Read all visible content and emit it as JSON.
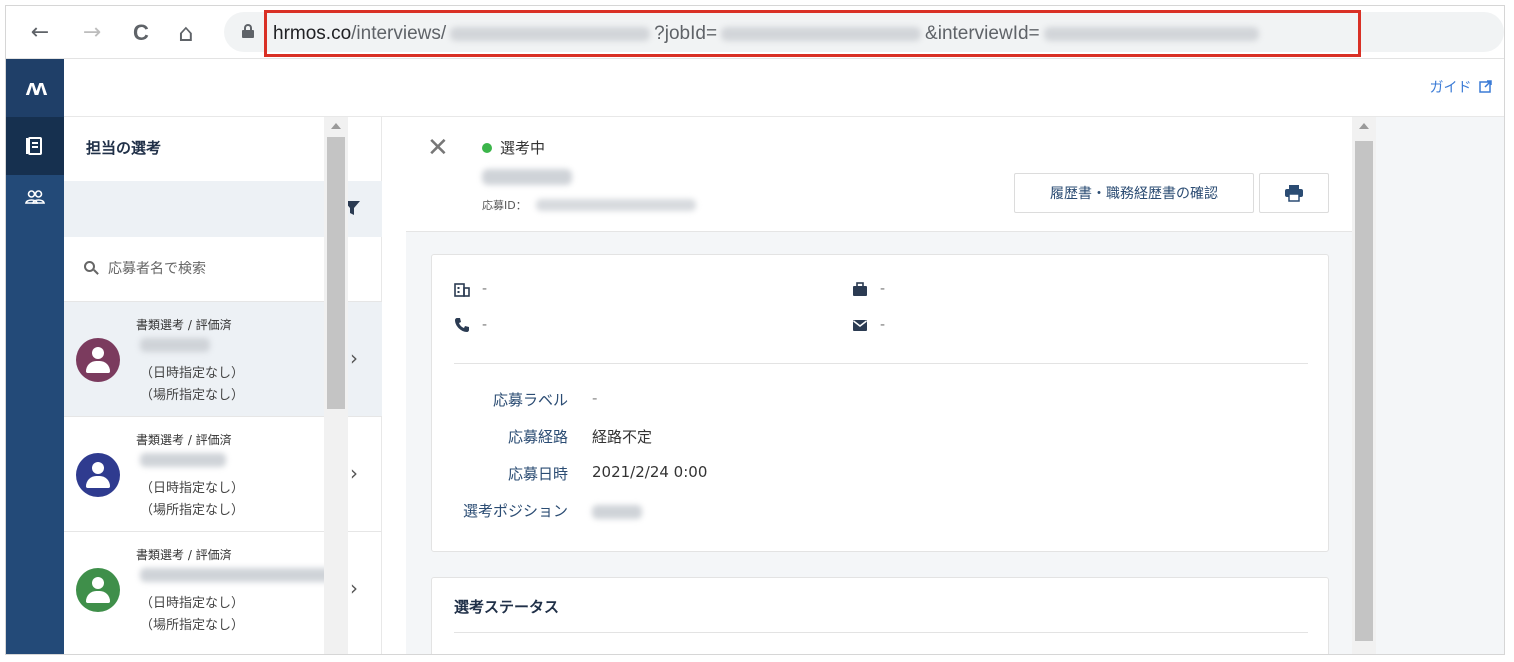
{
  "browser": {
    "back_icon": "←",
    "forward_icon": "→",
    "reload_icon": "C",
    "home_icon": "⌂",
    "url_host": "hrmos.co",
    "url_path": "/interviews/",
    "url_job_param": "?jobId=",
    "url_interview_param": "&interviewId="
  },
  "header": {
    "guide_label": "ガイド"
  },
  "rail": {
    "logo": "ʌʌ",
    "item_1_icon": "doc-icon",
    "item_2_icon": "people-icon"
  },
  "list": {
    "title": "担当の選考",
    "search_placeholder": "応募者名で検索",
    "candidates": [
      {
        "stage": "書類選考 / 評価済",
        "line1": "（日時指定なし）",
        "line2": "（場所指定なし）",
        "avatar_color": "#7b3b5e"
      },
      {
        "stage": "書類選考 / 評価済",
        "line1": "（日時指定なし）",
        "line2": "（場所指定なし）",
        "avatar_color": "#2f3b8f"
      },
      {
        "stage": "書類選考 / 評価済",
        "line1": "（日時指定なし）",
        "line2": "（場所指定なし）",
        "avatar_color": "#3f8f4a"
      }
    ]
  },
  "detail": {
    "status": "選考中",
    "status_color": "#3bb54a",
    "application_id_label": "応募ID：",
    "resume_button": "履歴書・職務経歴書の確認",
    "info": {
      "company": "-",
      "job": "-",
      "phone": "-",
      "email": "-"
    },
    "fields": {
      "label_label": "応募ラベル",
      "label_value": "-",
      "route_label": "応募経路",
      "route_value": "経路不定",
      "date_label": "応募日時",
      "date_value": "2021/2/24 0:00",
      "position_label": "選考ポジション"
    },
    "status_section_title": "選考ステータス"
  },
  "colors": {
    "accent": "#3b7bd6",
    "highlight": "#d93025",
    "rail": "#234a78"
  }
}
